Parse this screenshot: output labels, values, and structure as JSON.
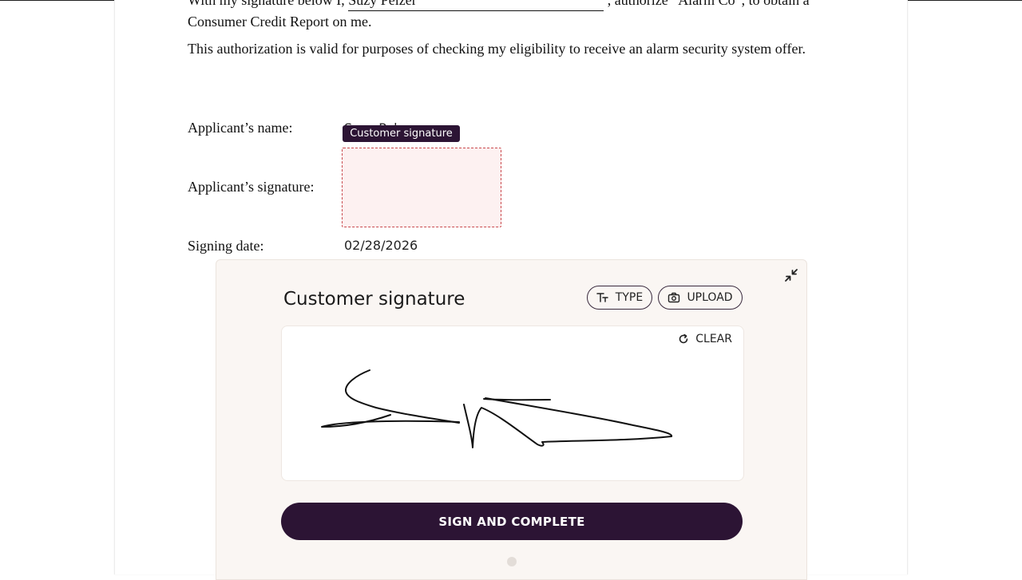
{
  "document": {
    "para1_pre": "With my signature below I,",
    "para1_name": "Suzy Pelzer",
    "para1_post": ", authorize “Alarm Co”, to obtain a Consumer Credit Report on me.",
    "para2": "This authorization is valid for purposes of checking my eligibility to receive an alarm security system offer.",
    "name_label": "Applicant’s name:",
    "name_value": "Suzy Pelzer",
    "signature_label": "Applicant’s signature:",
    "date_label": "Signing date:",
    "date_value": "02/28/2026"
  },
  "field_tooltip": "Customer signature",
  "signature_panel": {
    "title": "Customer signature",
    "type_label": "TYPE",
    "upload_label": "UPLOAD",
    "clear_label": "CLEAR",
    "sign_label": "SIGN AND COMPLETE"
  },
  "colors": {
    "primary": "#2c1434",
    "field_border": "#c9494d",
    "field_fill": "#fdf1f1",
    "panel_bg": "#faf6f3"
  },
  "icons": {
    "collapse": "collapse-arrows-icon",
    "type": "text-size-icon",
    "upload": "camera-icon",
    "clear": "refresh-icon"
  }
}
